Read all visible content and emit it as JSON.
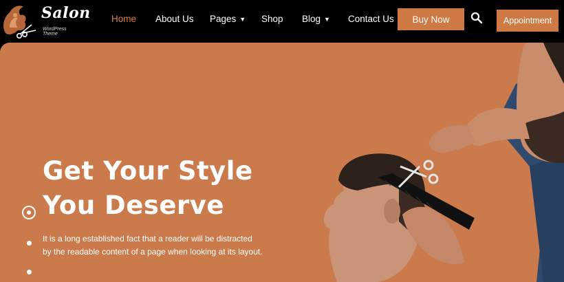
{
  "logo": {
    "title": "Salon",
    "subtitle": "WordPress Theme"
  },
  "nav": {
    "items": [
      {
        "label": "Home",
        "active": true
      },
      {
        "label": "About Us"
      },
      {
        "label": "Pages",
        "dropdown": true
      },
      {
        "label": "Shop"
      },
      {
        "label": "Blog",
        "dropdown": true
      },
      {
        "label": "Contact Us"
      }
    ],
    "buy_now": "Buy Now",
    "appointment": "Appointment"
  },
  "hero": {
    "headline_line1": "Get Your Style",
    "headline_line2": "You Deserve",
    "desc_line1": "It is a long established fact that a reader will be distracted",
    "desc_line2": "by the readable content of a page when looking at its layout."
  },
  "colors": {
    "accent": "#cf7a45",
    "hero_bg": "#cb7b4b",
    "active_nav": "#d97f4b"
  }
}
